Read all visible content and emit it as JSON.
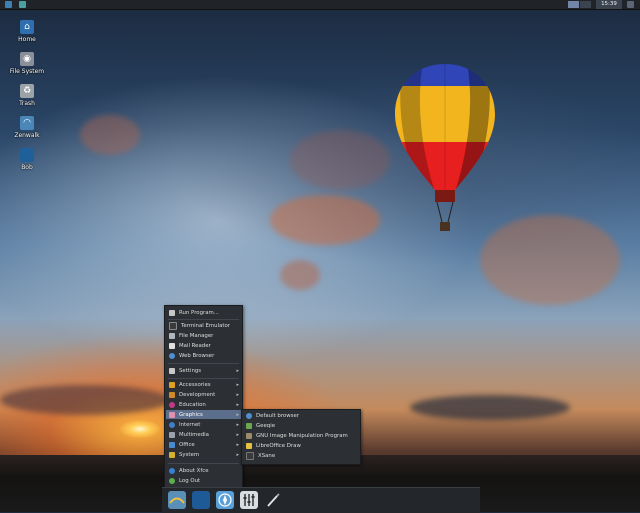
{
  "top_panel": {
    "clock": "15:39",
    "workspaces": [
      "1",
      "2"
    ]
  },
  "desktop_icons": [
    {
      "label": "Home",
      "icon": "home-icon"
    },
    {
      "label": "File System",
      "icon": "drive-icon"
    },
    {
      "label": "Trash",
      "icon": "trash-icon"
    },
    {
      "label": "Zenwalk",
      "icon": "zenwalk-icon"
    },
    {
      "label": "Bob",
      "icon": "folder-icon"
    }
  ],
  "main_menu": {
    "items": [
      {
        "label": "Run Program...",
        "icon": "run-icon",
        "submenu": false
      },
      {
        "label": "Terminal Emulator",
        "icon": "terminal-icon",
        "submenu": false
      },
      {
        "label": "File Manager",
        "icon": "file-manager-icon",
        "submenu": false
      },
      {
        "label": "Mail Reader",
        "icon": "mail-icon",
        "submenu": false
      },
      {
        "label": "Web Browser",
        "icon": "web-browser-icon",
        "submenu": false
      },
      {
        "label": "Settings",
        "icon": "settings-icon",
        "submenu": true
      },
      {
        "label": "Accessories",
        "icon": "accessories-icon",
        "submenu": true
      },
      {
        "label": "Development",
        "icon": "development-icon",
        "submenu": true
      },
      {
        "label": "Education",
        "icon": "education-icon",
        "submenu": true
      },
      {
        "label": "Graphics",
        "icon": "graphics-icon",
        "submenu": true,
        "selected": true
      },
      {
        "label": "Internet",
        "icon": "internet-icon",
        "submenu": true
      },
      {
        "label": "Multimedia",
        "icon": "multimedia-icon",
        "submenu": true
      },
      {
        "label": "Office",
        "icon": "office-icon",
        "submenu": true
      },
      {
        "label": "System",
        "icon": "system-icon",
        "submenu": true
      },
      {
        "label": "About Xfce",
        "icon": "about-icon",
        "submenu": false
      },
      {
        "label": "Log Out",
        "icon": "logout-icon",
        "submenu": false
      }
    ]
  },
  "graphics_submenu": {
    "items": [
      {
        "label": "Default browser",
        "icon": "browser-icon"
      },
      {
        "label": "Geeqie",
        "icon": "geeqie-icon"
      },
      {
        "label": "GNU Image Manipulation Program",
        "icon": "gimp-icon"
      },
      {
        "label": "LibreOffice Draw",
        "icon": "libreoffice-draw-icon"
      },
      {
        "label": "XSane",
        "icon": "xsane-icon"
      }
    ]
  },
  "dock": {
    "items": [
      {
        "icon": "zenwalk-menu-icon"
      },
      {
        "icon": "show-desktop-icon"
      },
      {
        "icon": "compass-icon"
      },
      {
        "icon": "equalizer-icon"
      },
      {
        "icon": "pen-icon"
      }
    ]
  },
  "colors": {
    "menu_bg": "#2c2f33",
    "menu_selected": "#5b6e8c",
    "panel_bg": "#202428"
  }
}
